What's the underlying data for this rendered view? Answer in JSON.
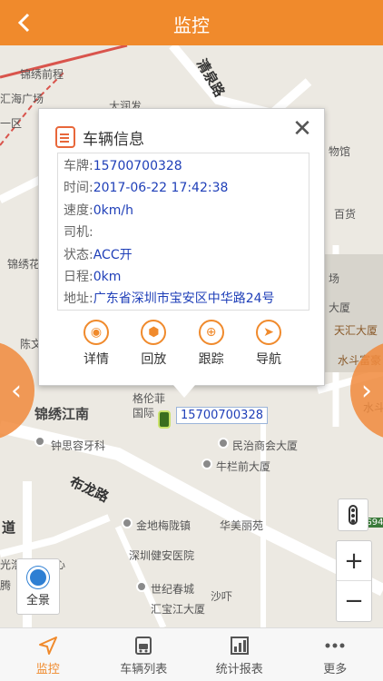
{
  "header": {
    "title": "监控"
  },
  "map": {
    "labels": [
      {
        "text": "锦绣前程"
      },
      {
        "text": "汇海广场"
      },
      {
        "text": "大润发"
      },
      {
        "text": "一区"
      },
      {
        "text": "清泉路"
      },
      {
        "text": "物馆"
      },
      {
        "text": "百货"
      },
      {
        "text": "锦绣花"
      },
      {
        "text": "场"
      },
      {
        "text": "大厦"
      },
      {
        "text": "天汇大厦"
      },
      {
        "text": "水斗富豪"
      },
      {
        "text": "陈文"
      },
      {
        "text": "水斗"
      },
      {
        "text": "格伦菲"
      },
      {
        "text": "国际"
      },
      {
        "text": "锦绣江南"
      },
      {
        "text": "钟思容牙科"
      },
      {
        "text": "民治商会大厦"
      },
      {
        "text": "牛栏前大厦"
      },
      {
        "text": "布龙路"
      },
      {
        "text": "金地梅陇镇"
      },
      {
        "text": "华美丽苑"
      },
      {
        "text": "深圳健安医院"
      },
      {
        "text": "世纪春城"
      },
      {
        "text": "沙吓"
      },
      {
        "text": "汇宝江大厦"
      },
      {
        "text": "光浩国际中心"
      },
      {
        "text": "腾"
      },
      {
        "text": "道"
      },
      {
        "text": "G94"
      }
    ],
    "car_tag": "15700700328",
    "fullview_label": "全景"
  },
  "popup": {
    "title": "车辆信息",
    "rows": [
      {
        "label": "车牌:",
        "value": "15700700328"
      },
      {
        "label": "时间:",
        "value": "2017-06-22 17:42:38"
      },
      {
        "label": "速度:",
        "value": "0km/h"
      },
      {
        "label": "司机:",
        "value": ""
      },
      {
        "label": "状态:",
        "value": "ACC开"
      },
      {
        "label": "日程:",
        "value": "0km"
      },
      {
        "label": "地址:",
        "value": "广东省深圳市宝安区中华路24号"
      }
    ],
    "actions": [
      {
        "label": "详情",
        "icon": "details-icon"
      },
      {
        "label": "回放",
        "icon": "playback-icon"
      },
      {
        "label": "跟踪",
        "icon": "track-icon"
      },
      {
        "label": "导航",
        "icon": "navigate-icon"
      }
    ]
  },
  "tabs": [
    {
      "label": "监控",
      "icon": "location-arrow-icon",
      "active": true
    },
    {
      "label": "车辆列表",
      "icon": "car-list-icon",
      "active": false
    },
    {
      "label": "统计报表",
      "icon": "chart-icon",
      "active": false
    },
    {
      "label": "更多",
      "icon": "more-icon",
      "active": false
    }
  ],
  "colors": {
    "accent": "#f08a2c",
    "link": "#1f3fb8"
  }
}
